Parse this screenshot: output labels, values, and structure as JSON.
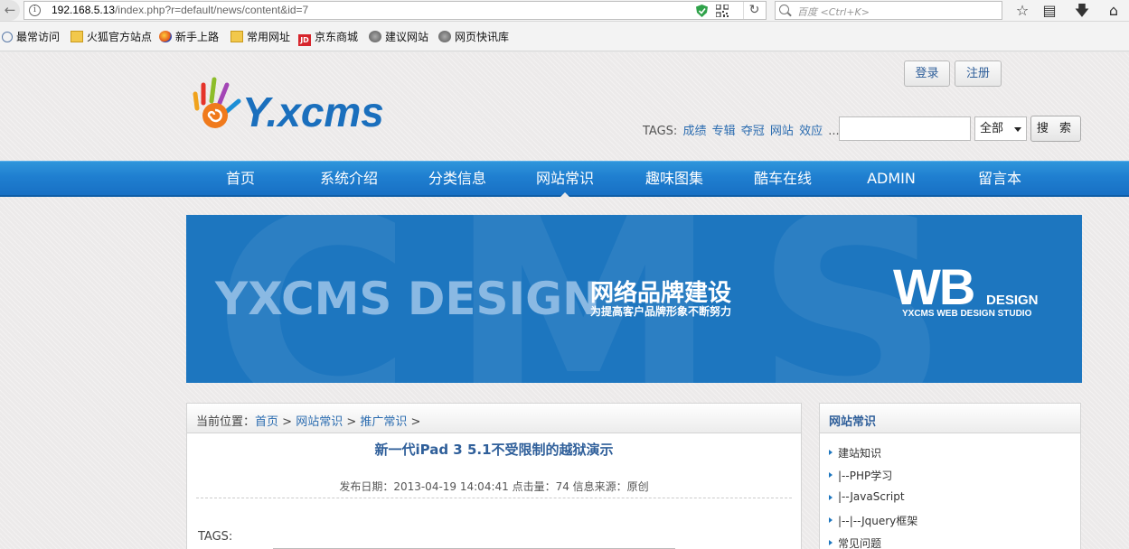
{
  "browser": {
    "url_host": "192.168.5.13",
    "url_path": "/index.php?r=default/news/content&id=7",
    "search_placeholder": "百度 <Ctrl+K>",
    "bookmarks": [
      "最常访问",
      "火狐官方站点",
      "新手上路",
      "常用网址",
      "京东商城",
      "建议网站",
      "网页快讯库"
    ]
  },
  "header": {
    "logo_text": "Y.xcms",
    "login_label": "登录",
    "register_label": "注册",
    "tags_label": "TAGS:",
    "tags": [
      "成绩",
      "专辑",
      "夺冠",
      "网站",
      "效应",
      "..."
    ],
    "search_value": "",
    "scope_selected": "全部",
    "search_button": "搜 索"
  },
  "nav": {
    "items": [
      "首页",
      "系统介绍",
      "分类信息",
      "网站常识",
      "趣味图集",
      "酷车在线",
      "ADMIN",
      "留言本"
    ],
    "active": "网站常识"
  },
  "banner": {
    "main": "YXCMS DESIGN",
    "cn_title": "网络品牌建设",
    "cn_sub": "为提高客户品牌形象不断努力",
    "wb": "WB",
    "design": "DESIGN",
    "studio": "YXCMS WEB DESIGN STUDIO",
    "bg_letters": "CMS"
  },
  "article": {
    "crumb_prefix": "当前位置：",
    "crumbs": [
      "首页",
      "网站常识",
      "推广常识"
    ],
    "title": "新一代iPad 3 5.1不受限制的越狱演示",
    "meta": "发布日期：2013-04-19 14:04:41  点击量：74   信息来源：原创",
    "tags_label": "TAGS:"
  },
  "sidebar": {
    "title": "网站常识",
    "items": [
      "建站知识",
      "|--PHP学习",
      "|--JavaScript",
      "|--|--Jquery框架",
      "常见问题"
    ]
  },
  "colors": {
    "nav_blue": "#1f7fd0",
    "banner_blue": "#1d76bf",
    "link": "#2b6cb0"
  }
}
